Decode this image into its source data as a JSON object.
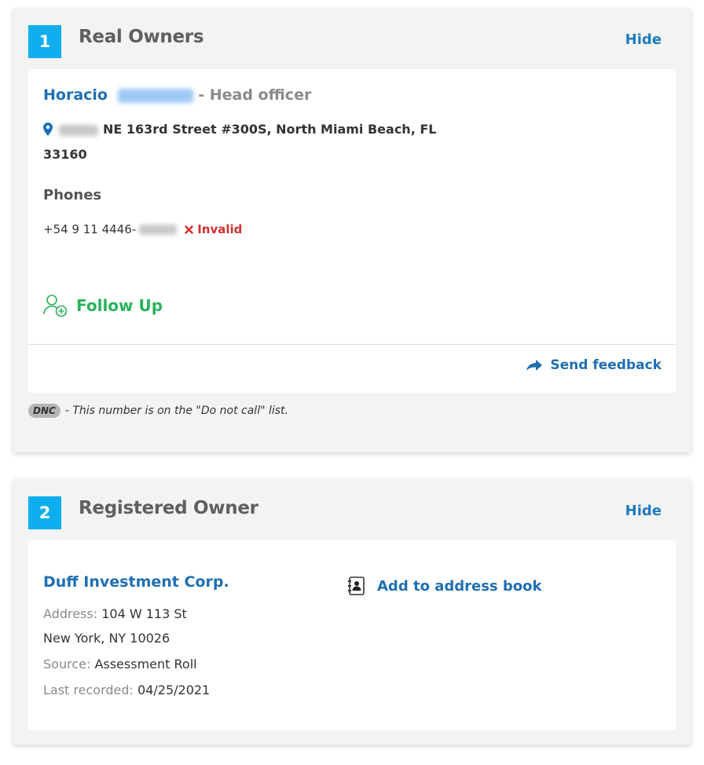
{
  "real_owners": {
    "number": "1",
    "title": "Real Owners",
    "hide_label": "Hide",
    "owner_first_name": "Horacio",
    "owner_role": "- Head officer",
    "address_line1": "NE 163rd Street #300S, North Miami Beach, FL",
    "address_line2": "33160",
    "phones_heading": "Phones",
    "phone_prefix": "+54 9 11 4446-",
    "phone_status": "Invalid",
    "follow_up_label": "Follow Up",
    "send_feedback_label": "Send feedback",
    "dnc_badge": "DNC",
    "dnc_text": "- This number is on the \"Do not call\" list."
  },
  "registered_owner": {
    "number": "2",
    "title": "Registered Owner",
    "hide_label": "Hide",
    "company_name": "Duff Investment Corp.",
    "address_label": "Address:",
    "address_value": "104 W 113 St",
    "city_line": "New York, NY 10026",
    "source_label": "Source:",
    "source_value": "Assessment Roll",
    "last_recorded_label": "Last recorded:",
    "last_recorded_value": "04/25/2021",
    "add_to_address_book_label": "Add to address book"
  },
  "colors": {
    "badge_blue": "#0dadee",
    "link_blue": "#1f6fb2",
    "follow_green": "#29b35a",
    "invalid_red": "#d12d2d",
    "panel_gray": "#f3f3f3"
  }
}
